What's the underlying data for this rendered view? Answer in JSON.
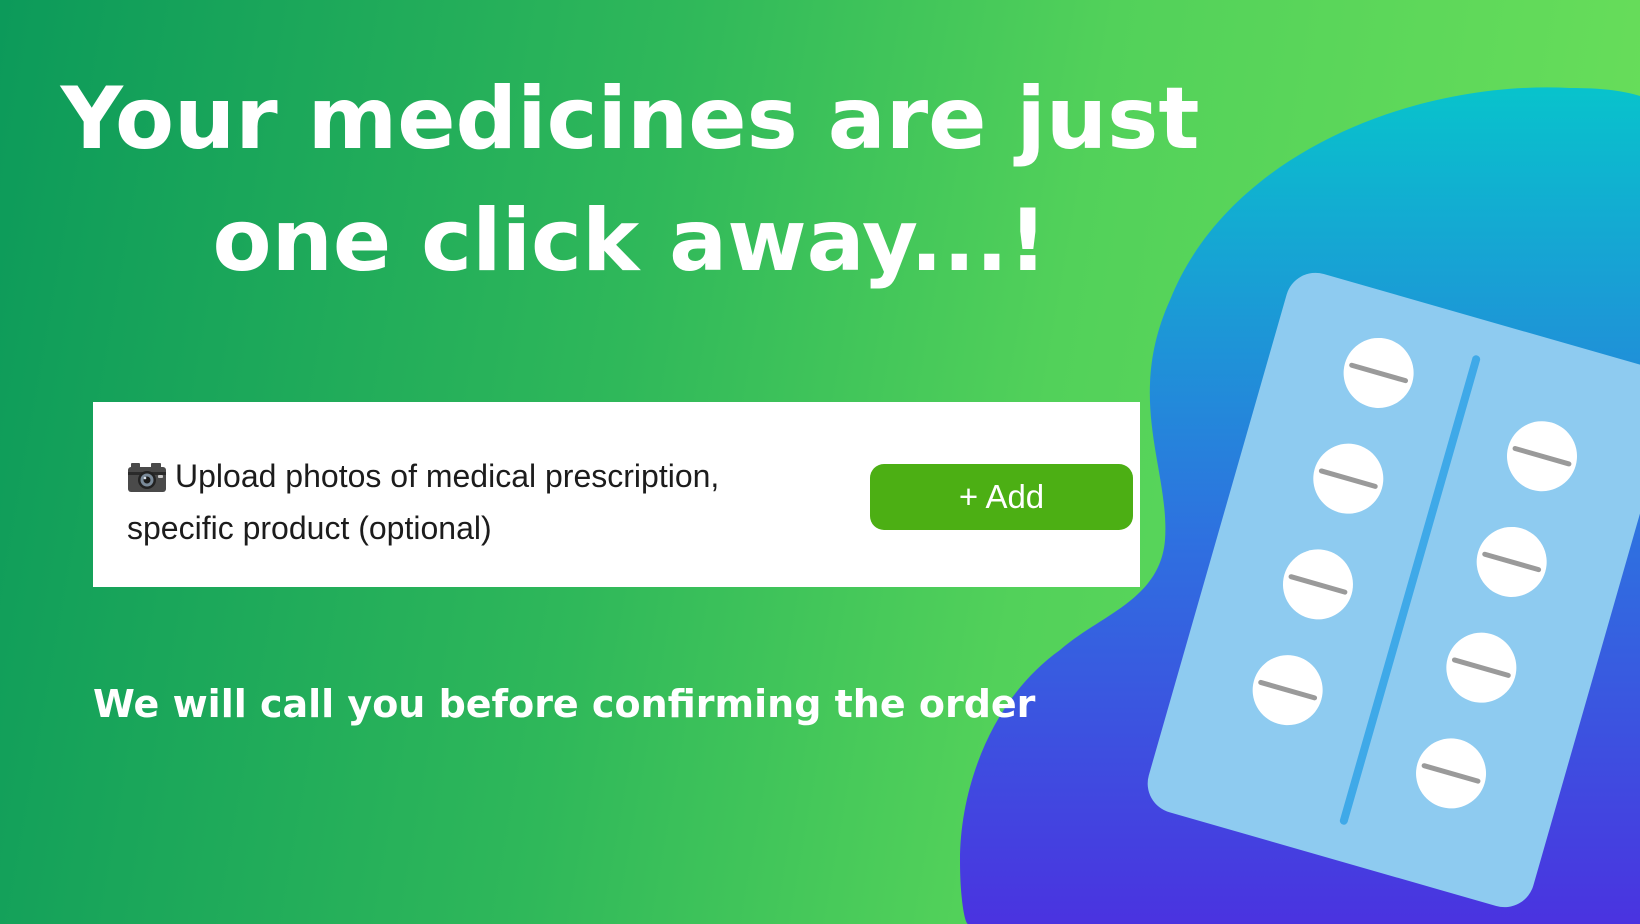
{
  "headline": {
    "line1": "Your medicines are just",
    "line2": "one click away...!"
  },
  "upload": {
    "icon": "camera-icon",
    "line1": "Upload photos of medical prescription,",
    "line2": "specific product (optional)",
    "button_label": "+ Add"
  },
  "subline": "We will call you before confirming the order",
  "colors": {
    "background_start": "#0c9a5a",
    "background_end": "#6ce05a",
    "blob_top": "#08c3cc",
    "blob_bottom": "#4a33e0",
    "button": "#4caf14",
    "pack": "#8ecbf0",
    "pack_divider": "#3fa9e8",
    "pill": "#ffffff",
    "pill_score": "#9a9a9a"
  },
  "illustration": {
    "icon": "blister-pack-icon",
    "pill_count": 8
  }
}
